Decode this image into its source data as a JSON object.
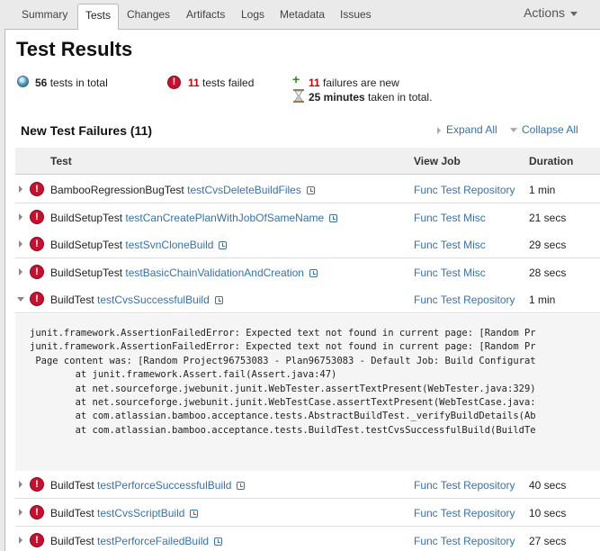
{
  "tabs": [
    {
      "label": "Summary"
    },
    {
      "label": "Tests"
    },
    {
      "label": "Changes"
    },
    {
      "label": "Artifacts"
    },
    {
      "label": "Logs"
    },
    {
      "label": "Metadata"
    },
    {
      "label": "Issues"
    }
  ],
  "active_tab": "Tests",
  "actions_label": "Actions",
  "page_title": "Test Results",
  "summary": {
    "total_count": "56",
    "total_text": "tests in total",
    "failed_count": "11",
    "failed_text": "tests failed",
    "new_count": "11",
    "new_text": "failures are new",
    "duration_value": "25 minutes",
    "duration_text": "taken in total."
  },
  "section": {
    "title": "New Test Failures (11)",
    "expand_all": "Expand All",
    "collapse_all": "Collapse All"
  },
  "table": {
    "headers": {
      "test": "Test",
      "job": "View Job",
      "duration": "Duration"
    },
    "rows": [
      {
        "cls": "BambooRegressionBugTest",
        "method": "testCvsDeleteBuildFiles",
        "job": "Func Test Repository",
        "duration": "1 min",
        "expanded": false
      },
      {
        "cls": "BuildSetupTest",
        "method": "testCanCreatePlanWithJobOfSameName",
        "job": "Func Test Misc",
        "duration": "21 secs",
        "expanded": false
      },
      {
        "cls": "BuildSetupTest",
        "method": "testSvnCloneBuild",
        "job": "Func Test Misc",
        "duration": "29 secs",
        "expanded": false
      },
      {
        "cls": "BuildSetupTest",
        "method": "testBasicChainValidationAndCreation",
        "job": "Func Test Misc",
        "duration": "28 secs",
        "expanded": false
      },
      {
        "cls": "BuildTest",
        "method": "testCvsSuccessfulBuild",
        "job": "Func Test Repository",
        "duration": "1 min",
        "expanded": true
      },
      {
        "cls": "BuildTest",
        "method": "testPerforceSuccessfulBuild",
        "job": "Func Test Repository",
        "duration": "40 secs",
        "expanded": false
      },
      {
        "cls": "BuildTest",
        "method": "testCvsScriptBuild",
        "job": "Func Test Repository",
        "duration": "10 secs",
        "expanded": false
      },
      {
        "cls": "BuildTest",
        "method": "testPerforceFailedBuild",
        "job": "Func Test Repository",
        "duration": "27 secs",
        "expanded": false
      }
    ]
  },
  "stack_trace": [
    "junit.framework.AssertionFailedError: Expected text not found in current page: [Random Pr",
    "junit.framework.AssertionFailedError: Expected text not found in current page: [Random Pr",
    " Page content was: [Random Project96753083 - Plan96753083 - Default Job: Build Configurat",
    "        at junit.framework.Assert.fail(Assert.java:47)",
    "        at net.sourceforge.jwebunit.junit.WebTester.assertTextPresent(WebTester.java:329)",
    "        at net.sourceforge.jwebunit.junit.WebTestCase.assertTextPresent(WebTestCase.java:",
    "        at com.atlassian.bamboo.acceptance.tests.AbstractBuildTest._verifyBuildDetails(Ab",
    "        at com.atlassian.bamboo.acceptance.tests.BuildTest.testCvsSuccessfulBuild(BuildTe"
  ]
}
